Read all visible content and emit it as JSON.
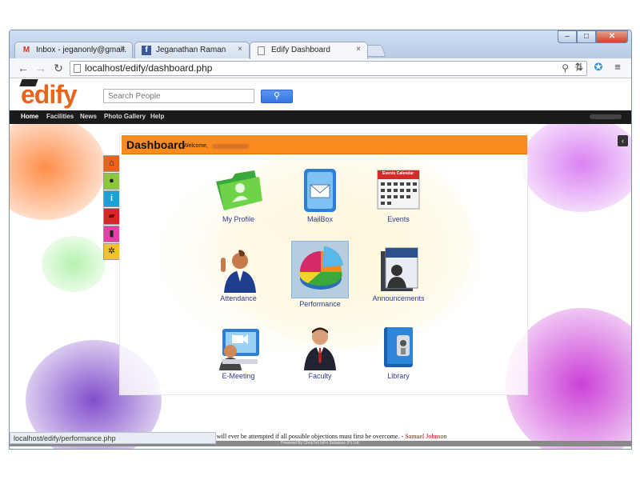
{
  "browser": {
    "tabs": [
      {
        "title": "Inbox - jeganonly@gmail.",
        "favicon": "gmail-icon",
        "close": "×"
      },
      {
        "title": "Jeganathan Raman",
        "favicon": "facebook-icon",
        "close": "×"
      },
      {
        "title": "Edify Dashboard",
        "favicon": "page-icon",
        "close": "×"
      }
    ],
    "window_buttons": {
      "minimize": "–",
      "maximize": "□",
      "close": "✕"
    },
    "nav": {
      "back": "←",
      "forward": "→",
      "reload": "↻"
    },
    "url": "localhost/edify/dashboard.php",
    "toolbar_icons": {
      "zoom": "⚲",
      "star": "☆",
      "translate": "⇅",
      "extension": "✪",
      "menu": "≡"
    },
    "status_url": "localhost/edify/performance.php"
  },
  "site": {
    "logo": "edify",
    "search": {
      "placeholder": "Search People",
      "button_icon": "⚲"
    },
    "nav_items": [
      "Home",
      "Facilities",
      "News",
      "Photo Gallery",
      "Help"
    ],
    "collapse_icon": "‹"
  },
  "side_icons": [
    {
      "icon": "home-icon",
      "glyph": "⌂",
      "color": "#e8641a"
    },
    {
      "icon": "user-icon",
      "glyph": "●",
      "color": "#8dc63f"
    },
    {
      "icon": "info-icon",
      "glyph": "i",
      "color": "#1aa3d9"
    },
    {
      "icon": "folder-icon",
      "glyph": "▰",
      "color": "#d62828"
    },
    {
      "icon": "mouse-icon",
      "glyph": "▮",
      "color": "#e63fa8"
    },
    {
      "icon": "settings-icon",
      "glyph": "✲",
      "color": "#f2c12e"
    }
  ],
  "dashboard": {
    "title": "Dashboard",
    "welcome": "Welcome,",
    "tiles": [
      {
        "label": "My Profile"
      },
      {
        "label": "MailBox"
      },
      {
        "label": "Events"
      },
      {
        "label": "Attendance"
      },
      {
        "label": "Performance"
      },
      {
        "label": "Announcements"
      },
      {
        "label": "E-Meeting"
      },
      {
        "label": "Faculty"
      },
      {
        "label": "Library"
      }
    ],
    "calendar_text": "Events Calendar"
  },
  "quote": {
    "text": "Nothing will ever be attempted if all possible objections must first be overcome. - ",
    "author": "Samuel Johnson"
  },
  "footer": "Powered By ChrisTell InFo Solutions (P) Ltd."
}
